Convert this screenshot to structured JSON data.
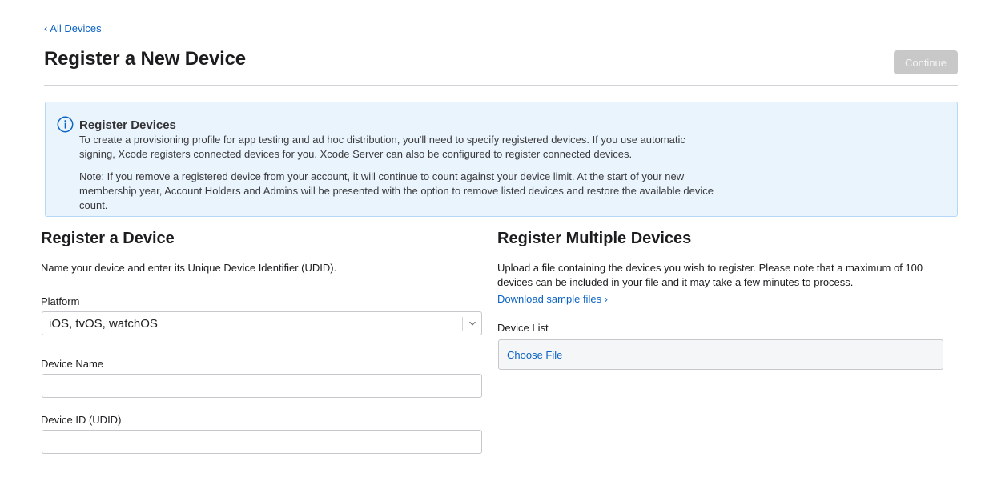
{
  "breadcrumb": {
    "chevron": "‹",
    "label": "All Devices"
  },
  "page": {
    "title": "Register a New Device",
    "continue_label": "Continue"
  },
  "info": {
    "icon": "info-icon",
    "title": "Register Devices",
    "paragraph1": "To create a provisioning profile for app testing and ad hoc distribution, you'll need to specify registered devices. If you use automatic signing, Xcode registers connected devices for you. Xcode Server can also be configured to register connected devices.",
    "paragraph2": "Note: If you remove a registered device from your account, it will continue to count against your device limit. At the start of your new membership year, Account Holders and Admins will be presented with the option to remove listed devices and restore the available device count."
  },
  "single": {
    "title": "Register a Device",
    "description": "Name your device and enter its Unique Device Identifier (UDID).",
    "platform_label": "Platform",
    "platform_value": "iOS, tvOS, watchOS",
    "device_name_label": "Device Name",
    "device_name_value": "",
    "device_id_label": "Device ID (UDID)",
    "device_id_value": ""
  },
  "multiple": {
    "title": "Register Multiple Devices",
    "description": "Upload a file containing the devices you wish to register. Please note that a maximum of 100 devices can be included in your file and it may take a few minutes to process.",
    "sample_link": "Download sample files ›",
    "device_list_label": "Device List",
    "choose_file_label": "Choose File"
  },
  "colors": {
    "link": "#0b63c4",
    "info_bg": "#eaf4fd",
    "info_border": "#b6d7f5",
    "disabled_button": "#c8c8c8"
  }
}
